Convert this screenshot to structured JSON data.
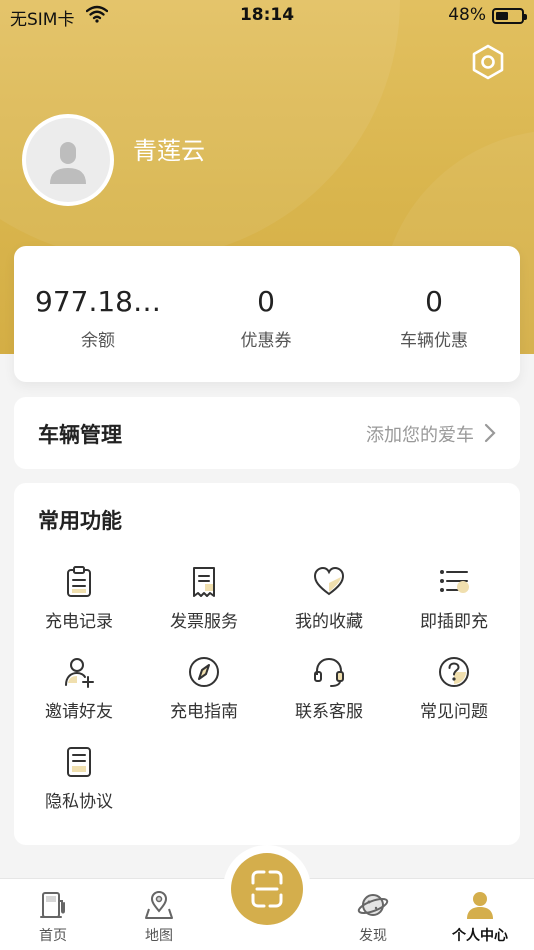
{
  "status_bar": {
    "carrier": "无SIM卡",
    "time": "18:14",
    "battery_pct": "48%",
    "battery_level": 0.48
  },
  "profile": {
    "username": "青莲云"
  },
  "stats": [
    {
      "value": "977.18…",
      "label": "余额"
    },
    {
      "value": "0",
      "label": "优惠券"
    },
    {
      "value": "0",
      "label": "车辆优惠"
    }
  ],
  "vehicle": {
    "title": "车辆管理",
    "action": "添加您的爱车"
  },
  "functions": {
    "title": "常用功能",
    "items": [
      {
        "label": "充电记录",
        "icon": "clipboard-icon"
      },
      {
        "label": "发票服务",
        "icon": "receipt-icon"
      },
      {
        "label": "我的收藏",
        "icon": "heart-icon"
      },
      {
        "label": "即插即充",
        "icon": "list-icon"
      },
      {
        "label": "邀请好友",
        "icon": "add-user-icon"
      },
      {
        "label": "充电指南",
        "icon": "compass-icon"
      },
      {
        "label": "联系客服",
        "icon": "headset-icon"
      },
      {
        "label": "常见问题",
        "icon": "question-icon"
      },
      {
        "label": "隐私协议",
        "icon": "document-icon"
      }
    ]
  },
  "tabs": [
    {
      "label": "首页",
      "icon": "charger-icon"
    },
    {
      "label": "地图",
      "icon": "map-pin-icon"
    },
    {
      "label": "发现",
      "icon": "planet-icon"
    },
    {
      "label": "个人中心",
      "icon": "person-icon",
      "active": true
    }
  ],
  "colors": {
    "brand_gold": "#d4ae4c",
    "accent_light": "#f0dfae"
  }
}
